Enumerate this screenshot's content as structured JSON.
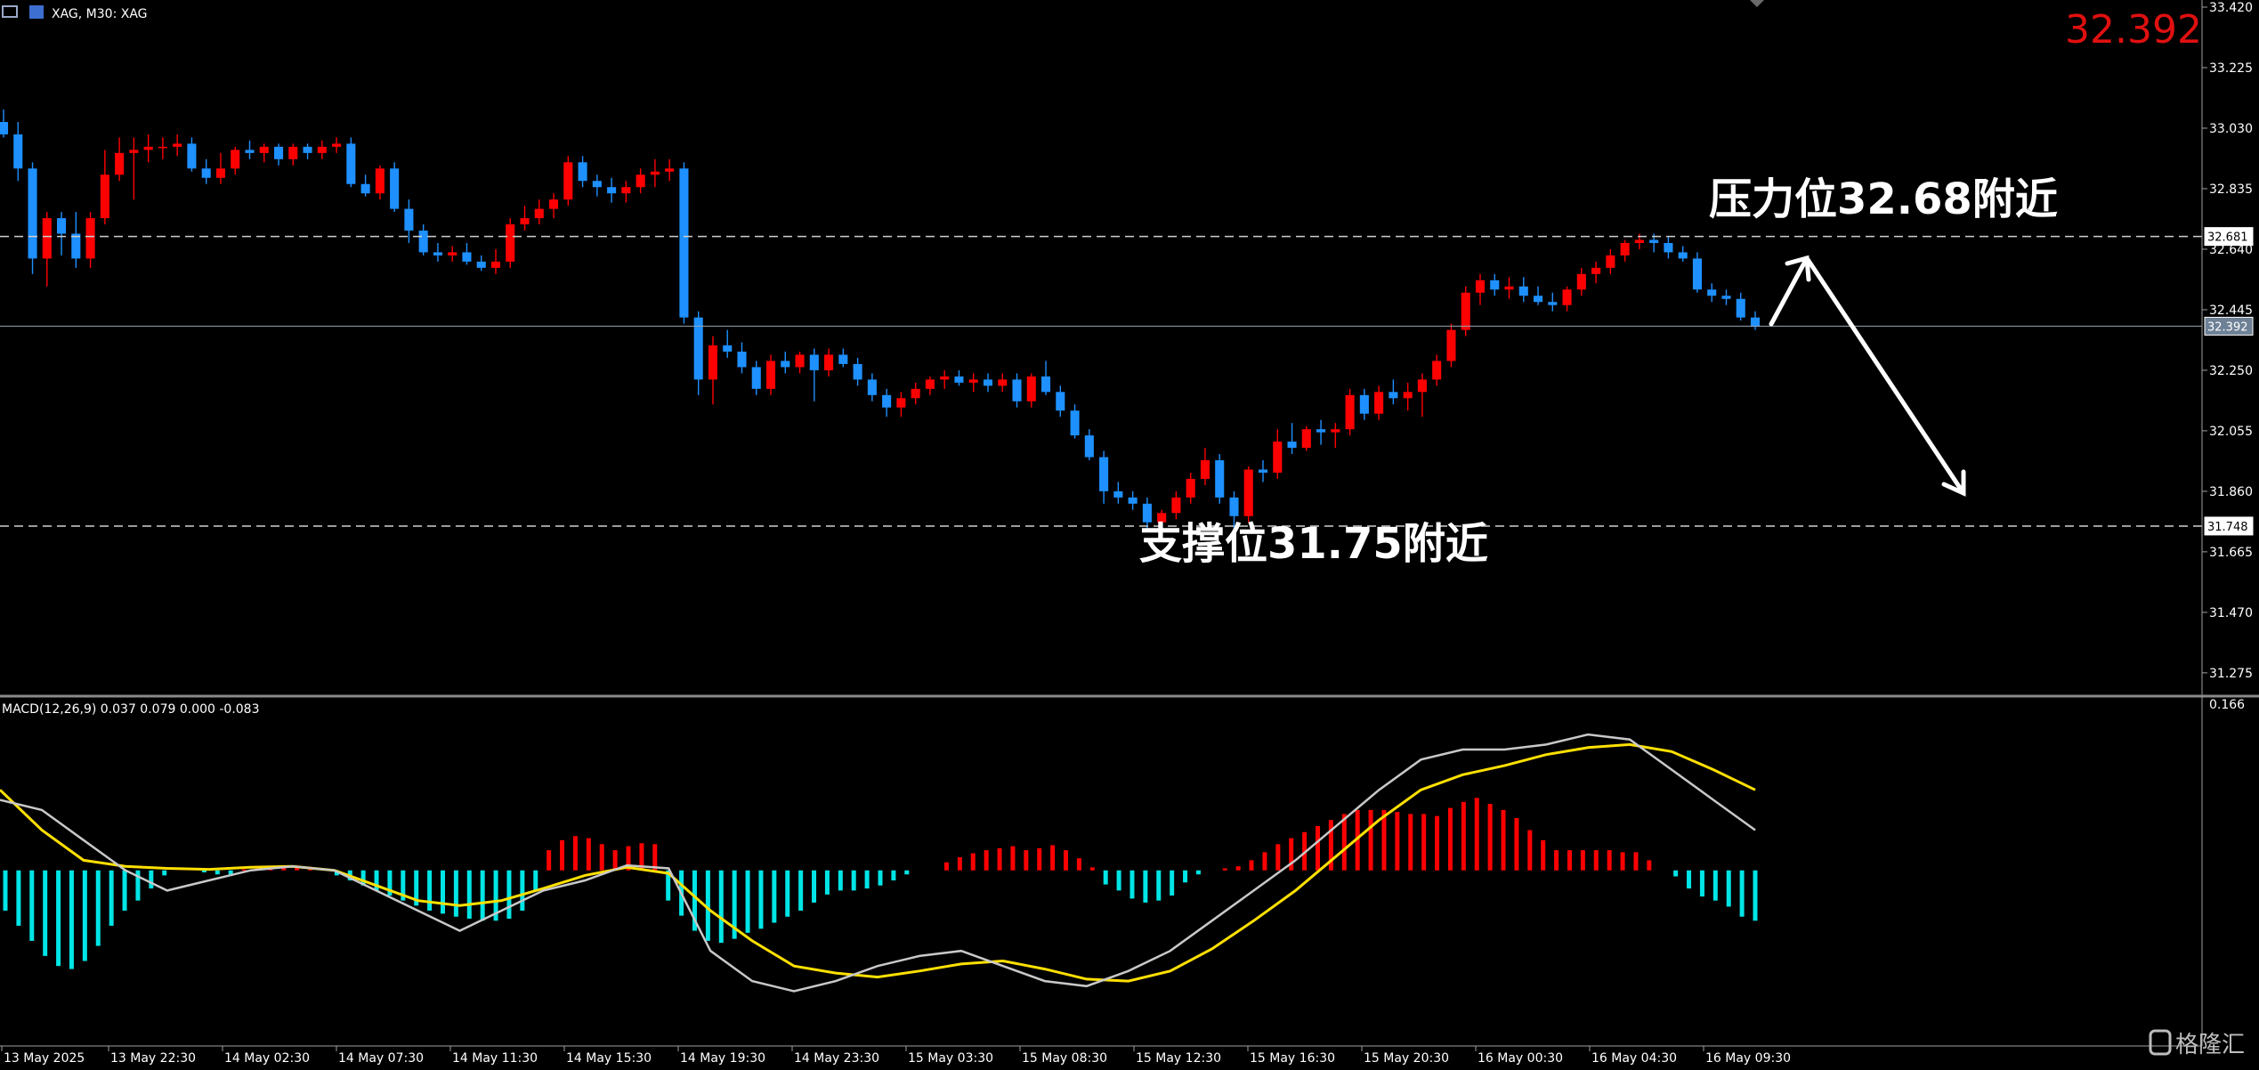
{
  "header": {
    "symbol_label": "XAG, M30:  XAG",
    "current_price": "32.392"
  },
  "price_axis": {
    "ticks": [
      "33.420",
      "33.225",
      "33.030",
      "32.835",
      "32.640",
      "32.445",
      "32.250",
      "32.055",
      "31.860",
      "31.665",
      "31.470",
      "31.275"
    ]
  },
  "levels": [
    {
      "value": 32.681,
      "tag": "32.681",
      "style": "dashed"
    },
    {
      "value": 32.392,
      "tag": "32.392",
      "style": "solid"
    },
    {
      "value": 31.748,
      "tag": "31.748",
      "style": "dashed"
    }
  ],
  "annotations": {
    "resistance": "压力位32.68附近",
    "support": "支撑位31.75附近"
  },
  "macd": {
    "label": "MACD(12,26,9) 0.037 0.079 0.000 -0.083",
    "axis_max": "0.166"
  },
  "time_axis": [
    "13 May 2025",
    "13 May 22:30",
    "14 May 02:30",
    "14 May 07:30",
    "14 May 11:30",
    "14 May 15:30",
    "14 May 19:30",
    "14 May 23:30",
    "15 May 03:30",
    "15 May 08:30",
    "15 May 12:30",
    "15 May 16:30",
    "15 May 20:30",
    "16 May 00:30",
    "16 May 04:30",
    "16 May 09:30"
  ],
  "watermark": "格隆汇",
  "colors": {
    "up": "#ff0000",
    "down": "#1e90ff",
    "hist_pos": "#ff0000",
    "hist_neg": "#00e5e5",
    "signal": "#ffe000",
    "macd_line": "#c8c8c8",
    "price_tag": "#e01010"
  },
  "chart_data": {
    "type": "candlestick",
    "symbol": "XAG",
    "timeframe": "M30",
    "ylim": [
      31.2,
      33.42
    ],
    "candles": [
      [
        33.05,
        33.09,
        33.0,
        33.01
      ],
      [
        33.01,
        33.05,
        32.86,
        32.9
      ],
      [
        32.9,
        32.92,
        32.56,
        32.61
      ],
      [
        32.61,
        32.76,
        32.52,
        32.74
      ],
      [
        32.74,
        32.76,
        32.62,
        32.69
      ],
      [
        32.69,
        32.76,
        32.58,
        32.61
      ],
      [
        32.61,
        32.76,
        32.58,
        32.74
      ],
      [
        32.74,
        32.96,
        32.72,
        32.88
      ],
      [
        32.88,
        33.0,
        32.86,
        32.95
      ],
      [
        32.95,
        33.0,
        32.8,
        32.96
      ],
      [
        32.96,
        33.01,
        32.92,
        32.97
      ],
      [
        32.97,
        33.0,
        32.93,
        32.97
      ],
      [
        32.97,
        33.01,
        32.94,
        32.98
      ],
      [
        32.98,
        33.0,
        32.89,
        32.9
      ],
      [
        32.9,
        32.93,
        32.85,
        32.87
      ],
      [
        32.87,
        32.95,
        32.85,
        32.9
      ],
      [
        32.9,
        32.97,
        32.88,
        32.96
      ],
      [
        32.96,
        32.99,
        32.93,
        32.95
      ],
      [
        32.95,
        32.98,
        32.92,
        32.97
      ],
      [
        32.97,
        32.98,
        32.91,
        32.93
      ],
      [
        32.93,
        32.98,
        32.91,
        32.97
      ],
      [
        32.97,
        32.98,
        32.93,
        32.95
      ],
      [
        32.95,
        32.99,
        32.93,
        32.97
      ],
      [
        32.97,
        33.0,
        32.95,
        32.98
      ],
      [
        32.98,
        33.0,
        32.84,
        32.85
      ],
      [
        32.85,
        32.88,
        32.81,
        32.82
      ],
      [
        32.82,
        32.91,
        32.8,
        32.9
      ],
      [
        32.9,
        32.92,
        32.76,
        32.77
      ],
      [
        32.77,
        32.8,
        32.66,
        32.7
      ],
      [
        32.7,
        32.72,
        32.62,
        32.63
      ],
      [
        32.63,
        32.66,
        32.6,
        32.62
      ],
      [
        32.62,
        32.65,
        32.6,
        32.63
      ],
      [
        32.63,
        32.66,
        32.59,
        32.6
      ],
      [
        32.6,
        32.62,
        32.57,
        32.58
      ],
      [
        32.58,
        32.64,
        32.56,
        32.6
      ],
      [
        32.6,
        32.74,
        32.58,
        32.72
      ],
      [
        32.72,
        32.78,
        32.7,
        32.74
      ],
      [
        32.74,
        32.8,
        32.72,
        32.77
      ],
      [
        32.77,
        32.82,
        32.74,
        32.8
      ],
      [
        32.8,
        32.94,
        32.78,
        32.92
      ],
      [
        32.92,
        32.94,
        32.84,
        32.86
      ],
      [
        32.86,
        32.88,
        32.81,
        32.84
      ],
      [
        32.84,
        32.87,
        32.79,
        32.82
      ],
      [
        32.82,
        32.86,
        32.79,
        32.84
      ],
      [
        32.84,
        32.9,
        32.82,
        32.88
      ],
      [
        32.88,
        32.93,
        32.84,
        32.89
      ],
      [
        32.89,
        32.93,
        32.86,
        32.9
      ],
      [
        32.9,
        32.92,
        32.4,
        32.42
      ],
      [
        32.42,
        32.44,
        32.17,
        32.22
      ],
      [
        32.22,
        32.36,
        32.14,
        32.33
      ],
      [
        32.33,
        32.38,
        32.29,
        32.31
      ],
      [
        32.31,
        32.34,
        32.24,
        32.26
      ],
      [
        32.26,
        32.28,
        32.17,
        32.19
      ],
      [
        32.19,
        32.3,
        32.17,
        32.28
      ],
      [
        32.28,
        32.31,
        32.24,
        32.26
      ],
      [
        32.26,
        32.31,
        32.24,
        32.3
      ],
      [
        32.3,
        32.32,
        32.15,
        32.25
      ],
      [
        32.25,
        32.32,
        32.23,
        32.3
      ],
      [
        32.3,
        32.32,
        32.26,
        32.27
      ],
      [
        32.27,
        32.29,
        32.2,
        32.22
      ],
      [
        32.22,
        32.24,
        32.15,
        32.17
      ],
      [
        32.17,
        32.19,
        32.1,
        32.13
      ],
      [
        32.13,
        32.18,
        32.1,
        32.16
      ],
      [
        32.16,
        32.21,
        32.14,
        32.19
      ],
      [
        32.19,
        32.23,
        32.17,
        32.22
      ],
      [
        32.22,
        32.25,
        32.19,
        32.23
      ],
      [
        32.23,
        32.25,
        32.2,
        32.21
      ],
      [
        32.21,
        32.24,
        32.18,
        32.22
      ],
      [
        32.22,
        32.24,
        32.18,
        32.2
      ],
      [
        32.2,
        32.24,
        32.18,
        32.22
      ],
      [
        32.22,
        32.24,
        32.13,
        32.15
      ],
      [
        32.15,
        32.24,
        32.13,
        32.23
      ],
      [
        32.23,
        32.28,
        32.17,
        32.18
      ],
      [
        32.18,
        32.2,
        32.1,
        32.12
      ],
      [
        32.12,
        32.14,
        32.03,
        32.04
      ],
      [
        32.04,
        32.06,
        31.96,
        31.97
      ],
      [
        31.97,
        31.99,
        31.82,
        31.86
      ],
      [
        31.86,
        31.89,
        31.82,
        31.84
      ],
      [
        31.84,
        31.86,
        31.8,
        31.82
      ],
      [
        31.82,
        31.84,
        31.74,
        31.76
      ],
      [
        31.76,
        31.8,
        31.74,
        31.79
      ],
      [
        31.79,
        31.86,
        31.77,
        31.84
      ],
      [
        31.84,
        31.92,
        31.82,
        31.9
      ],
      [
        31.9,
        32.0,
        31.88,
        31.96
      ],
      [
        31.96,
        31.98,
        31.82,
        31.84
      ],
      [
        31.84,
        31.86,
        31.7,
        31.78
      ],
      [
        31.78,
        31.94,
        31.76,
        31.93
      ],
      [
        31.93,
        31.96,
        31.89,
        31.92
      ],
      [
        31.92,
        32.06,
        31.9,
        32.02
      ],
      [
        32.02,
        32.08,
        31.98,
        32.0
      ],
      [
        32.0,
        32.07,
        31.99,
        32.06
      ],
      [
        32.06,
        32.09,
        32.01,
        32.05
      ],
      [
        32.05,
        32.08,
        32.0,
        32.06
      ],
      [
        32.06,
        32.19,
        32.04,
        32.17
      ],
      [
        32.17,
        32.19,
        32.09,
        32.11
      ],
      [
        32.11,
        32.2,
        32.09,
        32.18
      ],
      [
        32.18,
        32.22,
        32.14,
        32.16
      ],
      [
        32.16,
        32.21,
        32.12,
        32.18
      ],
      [
        32.18,
        32.24,
        32.1,
        32.22
      ],
      [
        32.22,
        32.3,
        32.2,
        32.28
      ],
      [
        32.28,
        32.4,
        32.26,
        32.38
      ],
      [
        32.38,
        32.52,
        32.36,
        32.5
      ],
      [
        32.5,
        32.56,
        32.46,
        32.54
      ],
      [
        32.54,
        32.56,
        32.49,
        32.51
      ],
      [
        32.51,
        32.55,
        32.48,
        32.52
      ],
      [
        32.52,
        32.55,
        32.47,
        32.49
      ],
      [
        32.49,
        32.52,
        32.46,
        32.47
      ],
      [
        32.47,
        32.5,
        32.44,
        32.46
      ],
      [
        32.46,
        32.52,
        32.44,
        32.51
      ],
      [
        32.51,
        32.58,
        32.49,
        32.56
      ],
      [
        32.56,
        32.6,
        32.53,
        32.58
      ],
      [
        32.58,
        32.64,
        32.56,
        32.62
      ],
      [
        32.62,
        32.67,
        32.6,
        32.66
      ],
      [
        32.66,
        32.69,
        32.64,
        32.67
      ],
      [
        32.67,
        32.69,
        32.63,
        32.66
      ],
      [
        32.66,
        32.68,
        32.61,
        32.63
      ],
      [
        32.63,
        32.65,
        32.6,
        32.61
      ],
      [
        32.61,
        32.63,
        32.5,
        32.51
      ],
      [
        32.51,
        32.53,
        32.47,
        32.49
      ],
      [
        32.49,
        32.51,
        32.46,
        32.48
      ],
      [
        32.48,
        32.5,
        32.41,
        32.42
      ],
      [
        32.42,
        32.44,
        32.38,
        32.39
      ]
    ],
    "macd_histogram": [
      -0.04,
      -0.055,
      -0.07,
      -0.085,
      -0.095,
      -0.098,
      -0.09,
      -0.075,
      -0.055,
      -0.04,
      -0.03,
      -0.018,
      -0.005,
      0,
      0,
      -0.002,
      -0.004,
      -0.004,
      0.001,
      0.002,
      0.003,
      0.004,
      0.003,
      0.003,
      0.002,
      -0.005,
      -0.01,
      -0.015,
      -0.02,
      -0.025,
      -0.03,
      -0.035,
      -0.04,
      -0.043,
      -0.046,
      -0.048,
      -0.05,
      -0.05,
      -0.048,
      -0.04,
      -0.02,
      0.02,
      0.03,
      0.034,
      0.032,
      0.026,
      0.02,
      0.024,
      0.027,
      0.026,
      -0.03,
      -0.045,
      -0.06,
      -0.07,
      -0.072,
      -0.068,
      -0.062,
      -0.058,
      -0.052,
      -0.046,
      -0.04,
      -0.032,
      -0.024,
      -0.02,
      -0.02,
      -0.018,
      -0.015,
      -0.01,
      -0.004,
      0,
      0,
      0.008,
      0.013,
      0.017,
      0.02,
      0.022,
      0.024,
      0.02,
      0.022,
      0.025,
      0.02,
      0.012,
      0.003,
      -0.014,
      -0.02,
      -0.028,
      -0.032,
      -0.03,
      -0.025,
      -0.012,
      -0.004,
      0,
      0.002,
      0.004,
      0.01,
      0.018,
      0.026,
      0.032,
      0.038,
      0.044,
      0.05,
      0.056,
      0.06,
      0.06,
      0.06,
      0.058,
      0.056,
      0.056,
      0.054,
      0.062,
      0.068,
      0.072,
      0.066,
      0.06,
      0.052,
      0.04,
      0.03,
      0.02,
      0.02,
      0.02,
      0.02,
      0.02,
      0.018,
      0.018,
      0.01,
      0,
      -0.006,
      -0.018,
      -0.026,
      -0.03,
      -0.036,
      -0.046,
      -0.05
    ],
    "macd_line": [
      0.07,
      0.06,
      0.03,
      0.0,
      -0.02,
      -0.01,
      0.0,
      0.004,
      0.0,
      -0.02,
      -0.04,
      -0.06,
      -0.04,
      -0.02,
      -0.01,
      0.005,
      0.002,
      -0.08,
      -0.11,
      -0.12,
      -0.11,
      -0.095,
      -0.085,
      -0.08,
      -0.095,
      -0.11,
      -0.115,
      -0.1,
      -0.08,
      -0.05,
      -0.02,
      0.01,
      0.045,
      0.08,
      0.11,
      0.12,
      0.12,
      0.125,
      0.135,
      0.13,
      0.1,
      0.07,
      0.04
    ],
    "signal_line": [
      0.08,
      0.04,
      0.01,
      0.004,
      0.002,
      0.001,
      0.003,
      0.004,
      0.0,
      -0.015,
      -0.03,
      -0.035,
      -0.03,
      -0.018,
      -0.005,
      0.003,
      -0.003,
      -0.04,
      -0.07,
      -0.095,
      -0.102,
      -0.106,
      -0.1,
      -0.093,
      -0.09,
      -0.098,
      -0.108,
      -0.11,
      -0.1,
      -0.078,
      -0.05,
      -0.02,
      0.015,
      0.05,
      0.08,
      0.095,
      0.104,
      0.115,
      0.122,
      0.125,
      0.118,
      0.1,
      0.08
    ]
  }
}
